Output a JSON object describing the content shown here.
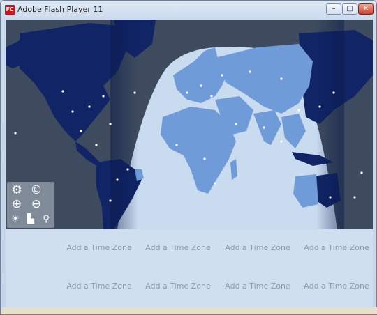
{
  "window": {
    "title": "Adobe Flash Player 11",
    "icon_text": "FC"
  },
  "controls": {
    "minimize": "–",
    "maximize": "□",
    "close": "✕"
  },
  "map": {
    "ocean_color": "#0b1a4a",
    "night_land_color": "#112766",
    "day_ocean_color": "#c7d9ee",
    "day_land_color": "#6e9ad6"
  },
  "toolbar": {
    "settings_icon": "gear-icon",
    "clock_icon": "copyright-icon",
    "zoom_in_icon": "zoom-in-icon",
    "zoom_out_icon": "zoom-out-icon",
    "sun_icon": "sun-icon",
    "city_icon": "city-icon",
    "pin_icon": "pin-icon"
  },
  "timezones": [
    "Add a Time Zone",
    "Add a Time Zone",
    "Add a Time Zone",
    "Add a Time Zone",
    "Add a Time Zone",
    "Add a Time Zone",
    "Add a Time Zone",
    "Add a Time Zone"
  ]
}
